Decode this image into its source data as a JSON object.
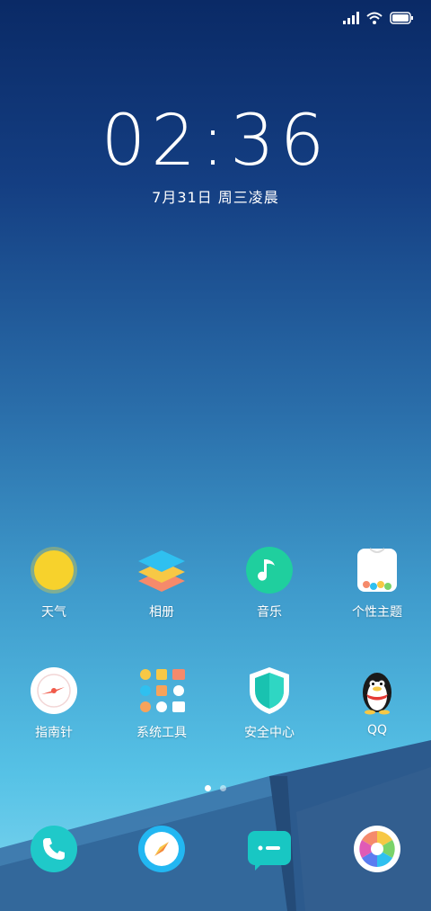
{
  "status": {
    "icons": [
      "signal-icon",
      "wifi-icon",
      "battery-icon"
    ]
  },
  "lockscreen": {
    "time": "02:36",
    "date": "7月31日  周三凌晨"
  },
  "apps_row1": [
    {
      "label": "天气",
      "icon": "weather-sun-icon"
    },
    {
      "label": "相册",
      "icon": "gallery-layers-icon"
    },
    {
      "label": "音乐",
      "icon": "music-note-icon"
    },
    {
      "label": "个性主题",
      "icon": "themes-shirt-icon"
    }
  ],
  "apps_row2": [
    {
      "label": "指南针",
      "icon": "compass-icon"
    },
    {
      "label": "系统工具",
      "icon": "tools-folder-icon"
    },
    {
      "label": "安全中心",
      "icon": "security-shield-icon"
    },
    {
      "label": "QQ",
      "icon": "qq-penguin-icon"
    }
  ],
  "pager": {
    "count": 2,
    "active": 0
  },
  "dock": [
    {
      "icon": "phone-icon"
    },
    {
      "icon": "browser-compass-icon"
    },
    {
      "icon": "messages-icon"
    },
    {
      "icon": "camera-shutter-icon"
    }
  ],
  "colors": {
    "sun": "#f7d22c",
    "music": "#1fcf9e",
    "shield": "#19c2b0",
    "phone": "#1fc9c9",
    "browser": "#22b7f2",
    "messages": "#18c7c3"
  }
}
